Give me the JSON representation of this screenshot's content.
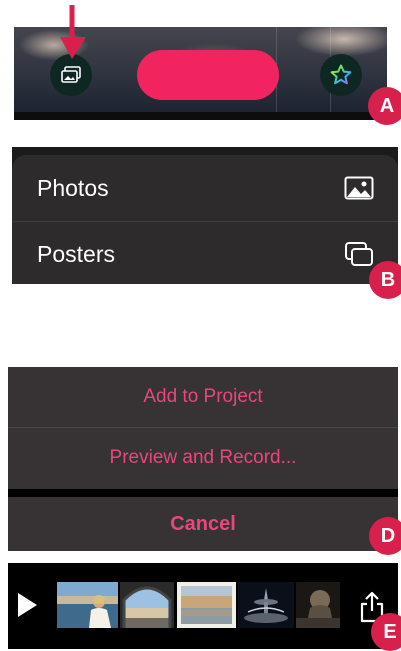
{
  "panels": {
    "a": {
      "badge": "A",
      "icons": {
        "arrow": "red-down-arrow-icon",
        "photos_button": "photos-stack-icon",
        "favorites_button": "star-icon"
      },
      "colors": {
        "record_button": "#f2245f",
        "icon_button_bg": "#0f2723"
      }
    },
    "b": {
      "badge": "B",
      "menu": [
        {
          "label": "Photos",
          "icon": "photo-icon"
        },
        {
          "label": "Posters",
          "icon": "posters-icon"
        }
      ]
    },
    "d": {
      "badge": "D",
      "actions": [
        {
          "label": "Add to Project"
        },
        {
          "label": "Preview and Record..."
        }
      ],
      "cancel_label": "Cancel",
      "colors": {
        "action_text": "#e8477b"
      }
    },
    "e": {
      "badge": "E",
      "icons": {
        "play": "play-icon",
        "share": "share-icon"
      },
      "thumbnails": [
        {
          "name": "thumbnail-woman-harbor"
        },
        {
          "name": "thumbnail-arch-square"
        },
        {
          "name": "thumbnail-building-reflection"
        },
        {
          "name": "thumbnail-fountain-night"
        },
        {
          "name": "thumbnail-lion-statue"
        }
      ]
    }
  },
  "badge_color": "#d7214c"
}
